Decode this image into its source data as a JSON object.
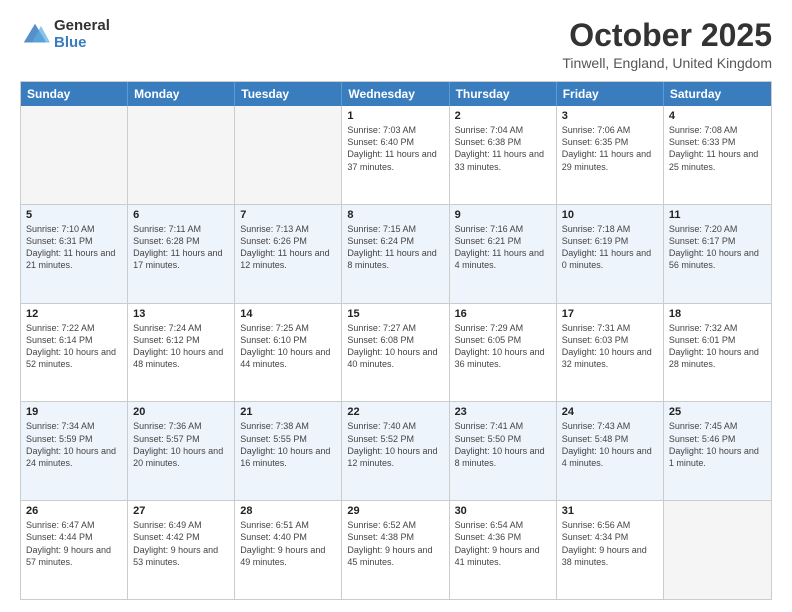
{
  "header": {
    "logo_general": "General",
    "logo_blue": "Blue",
    "month_title": "October 2025",
    "location": "Tinwell, England, United Kingdom"
  },
  "calendar": {
    "days_of_week": [
      "Sunday",
      "Monday",
      "Tuesday",
      "Wednesday",
      "Thursday",
      "Friday",
      "Saturday"
    ],
    "rows": [
      [
        {
          "day": "",
          "sunrise": "",
          "sunset": "",
          "daylight": "",
          "empty": true
        },
        {
          "day": "",
          "sunrise": "",
          "sunset": "",
          "daylight": "",
          "empty": true
        },
        {
          "day": "",
          "sunrise": "",
          "sunset": "",
          "daylight": "",
          "empty": true
        },
        {
          "day": "1",
          "sunrise": "Sunrise: 7:03 AM",
          "sunset": "Sunset: 6:40 PM",
          "daylight": "Daylight: 11 hours and 37 minutes.",
          "empty": false
        },
        {
          "day": "2",
          "sunrise": "Sunrise: 7:04 AM",
          "sunset": "Sunset: 6:38 PM",
          "daylight": "Daylight: 11 hours and 33 minutes.",
          "empty": false
        },
        {
          "day": "3",
          "sunrise": "Sunrise: 7:06 AM",
          "sunset": "Sunset: 6:35 PM",
          "daylight": "Daylight: 11 hours and 29 minutes.",
          "empty": false
        },
        {
          "day": "4",
          "sunrise": "Sunrise: 7:08 AM",
          "sunset": "Sunset: 6:33 PM",
          "daylight": "Daylight: 11 hours and 25 minutes.",
          "empty": false
        }
      ],
      [
        {
          "day": "5",
          "sunrise": "Sunrise: 7:10 AM",
          "sunset": "Sunset: 6:31 PM",
          "daylight": "Daylight: 11 hours and 21 minutes.",
          "empty": false
        },
        {
          "day": "6",
          "sunrise": "Sunrise: 7:11 AM",
          "sunset": "Sunset: 6:28 PM",
          "daylight": "Daylight: 11 hours and 17 minutes.",
          "empty": false
        },
        {
          "day": "7",
          "sunrise": "Sunrise: 7:13 AM",
          "sunset": "Sunset: 6:26 PM",
          "daylight": "Daylight: 11 hours and 12 minutes.",
          "empty": false
        },
        {
          "day": "8",
          "sunrise": "Sunrise: 7:15 AM",
          "sunset": "Sunset: 6:24 PM",
          "daylight": "Daylight: 11 hours and 8 minutes.",
          "empty": false
        },
        {
          "day": "9",
          "sunrise": "Sunrise: 7:16 AM",
          "sunset": "Sunset: 6:21 PM",
          "daylight": "Daylight: 11 hours and 4 minutes.",
          "empty": false
        },
        {
          "day": "10",
          "sunrise": "Sunrise: 7:18 AM",
          "sunset": "Sunset: 6:19 PM",
          "daylight": "Daylight: 11 hours and 0 minutes.",
          "empty": false
        },
        {
          "day": "11",
          "sunrise": "Sunrise: 7:20 AM",
          "sunset": "Sunset: 6:17 PM",
          "daylight": "Daylight: 10 hours and 56 minutes.",
          "empty": false
        }
      ],
      [
        {
          "day": "12",
          "sunrise": "Sunrise: 7:22 AM",
          "sunset": "Sunset: 6:14 PM",
          "daylight": "Daylight: 10 hours and 52 minutes.",
          "empty": false
        },
        {
          "day": "13",
          "sunrise": "Sunrise: 7:24 AM",
          "sunset": "Sunset: 6:12 PM",
          "daylight": "Daylight: 10 hours and 48 minutes.",
          "empty": false
        },
        {
          "day": "14",
          "sunrise": "Sunrise: 7:25 AM",
          "sunset": "Sunset: 6:10 PM",
          "daylight": "Daylight: 10 hours and 44 minutes.",
          "empty": false
        },
        {
          "day": "15",
          "sunrise": "Sunrise: 7:27 AM",
          "sunset": "Sunset: 6:08 PM",
          "daylight": "Daylight: 10 hours and 40 minutes.",
          "empty": false
        },
        {
          "day": "16",
          "sunrise": "Sunrise: 7:29 AM",
          "sunset": "Sunset: 6:05 PM",
          "daylight": "Daylight: 10 hours and 36 minutes.",
          "empty": false
        },
        {
          "day": "17",
          "sunrise": "Sunrise: 7:31 AM",
          "sunset": "Sunset: 6:03 PM",
          "daylight": "Daylight: 10 hours and 32 minutes.",
          "empty": false
        },
        {
          "day": "18",
          "sunrise": "Sunrise: 7:32 AM",
          "sunset": "Sunset: 6:01 PM",
          "daylight": "Daylight: 10 hours and 28 minutes.",
          "empty": false
        }
      ],
      [
        {
          "day": "19",
          "sunrise": "Sunrise: 7:34 AM",
          "sunset": "Sunset: 5:59 PM",
          "daylight": "Daylight: 10 hours and 24 minutes.",
          "empty": false
        },
        {
          "day": "20",
          "sunrise": "Sunrise: 7:36 AM",
          "sunset": "Sunset: 5:57 PM",
          "daylight": "Daylight: 10 hours and 20 minutes.",
          "empty": false
        },
        {
          "day": "21",
          "sunrise": "Sunrise: 7:38 AM",
          "sunset": "Sunset: 5:55 PM",
          "daylight": "Daylight: 10 hours and 16 minutes.",
          "empty": false
        },
        {
          "day": "22",
          "sunrise": "Sunrise: 7:40 AM",
          "sunset": "Sunset: 5:52 PM",
          "daylight": "Daylight: 10 hours and 12 minutes.",
          "empty": false
        },
        {
          "day": "23",
          "sunrise": "Sunrise: 7:41 AM",
          "sunset": "Sunset: 5:50 PM",
          "daylight": "Daylight: 10 hours and 8 minutes.",
          "empty": false
        },
        {
          "day": "24",
          "sunrise": "Sunrise: 7:43 AM",
          "sunset": "Sunset: 5:48 PM",
          "daylight": "Daylight: 10 hours and 4 minutes.",
          "empty": false
        },
        {
          "day": "25",
          "sunrise": "Sunrise: 7:45 AM",
          "sunset": "Sunset: 5:46 PM",
          "daylight": "Daylight: 10 hours and 1 minute.",
          "empty": false
        }
      ],
      [
        {
          "day": "26",
          "sunrise": "Sunrise: 6:47 AM",
          "sunset": "Sunset: 4:44 PM",
          "daylight": "Daylight: 9 hours and 57 minutes.",
          "empty": false
        },
        {
          "day": "27",
          "sunrise": "Sunrise: 6:49 AM",
          "sunset": "Sunset: 4:42 PM",
          "daylight": "Daylight: 9 hours and 53 minutes.",
          "empty": false
        },
        {
          "day": "28",
          "sunrise": "Sunrise: 6:51 AM",
          "sunset": "Sunset: 4:40 PM",
          "daylight": "Daylight: 9 hours and 49 minutes.",
          "empty": false
        },
        {
          "day": "29",
          "sunrise": "Sunrise: 6:52 AM",
          "sunset": "Sunset: 4:38 PM",
          "daylight": "Daylight: 9 hours and 45 minutes.",
          "empty": false
        },
        {
          "day": "30",
          "sunrise": "Sunrise: 6:54 AM",
          "sunset": "Sunset: 4:36 PM",
          "daylight": "Daylight: 9 hours and 41 minutes.",
          "empty": false
        },
        {
          "day": "31",
          "sunrise": "Sunrise: 6:56 AM",
          "sunset": "Sunset: 4:34 PM",
          "daylight": "Daylight: 9 hours and 38 minutes.",
          "empty": false
        },
        {
          "day": "",
          "sunrise": "",
          "sunset": "",
          "daylight": "",
          "empty": true
        }
      ]
    ]
  }
}
